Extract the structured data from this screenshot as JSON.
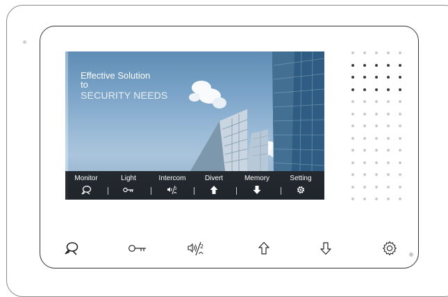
{
  "screen": {
    "headline_line1": "Effective Solution",
    "headline_line2": "to",
    "headline_line3": "SECURITY NEEDS"
  },
  "toolbar": {
    "items": [
      {
        "label": "Monitor",
        "icon": "monitor-icon"
      },
      {
        "label": "Light",
        "icon": "key-icon"
      },
      {
        "label": "Intercom",
        "icon": "intercom-icon"
      },
      {
        "label": "Divert",
        "icon": "arrow-up-icon"
      },
      {
        "label": "Memory",
        "icon": "arrow-down-icon"
      },
      {
        "label": "Setting",
        "icon": "gear-icon"
      }
    ],
    "separator": "|"
  },
  "hardware_buttons": [
    {
      "icon": "monitor-icon"
    },
    {
      "icon": "key-icon"
    },
    {
      "icon": "intercom-icon"
    },
    {
      "icon": "arrow-up-icon"
    },
    {
      "icon": "arrow-down-icon"
    },
    {
      "icon": "gear-icon"
    }
  ],
  "colors": {
    "toolbar_bg": "#1a1a1a",
    "sky": "#7aa3c8",
    "speaker_dark": "#3a3a3a",
    "speaker_light": "#c9c9c9"
  }
}
